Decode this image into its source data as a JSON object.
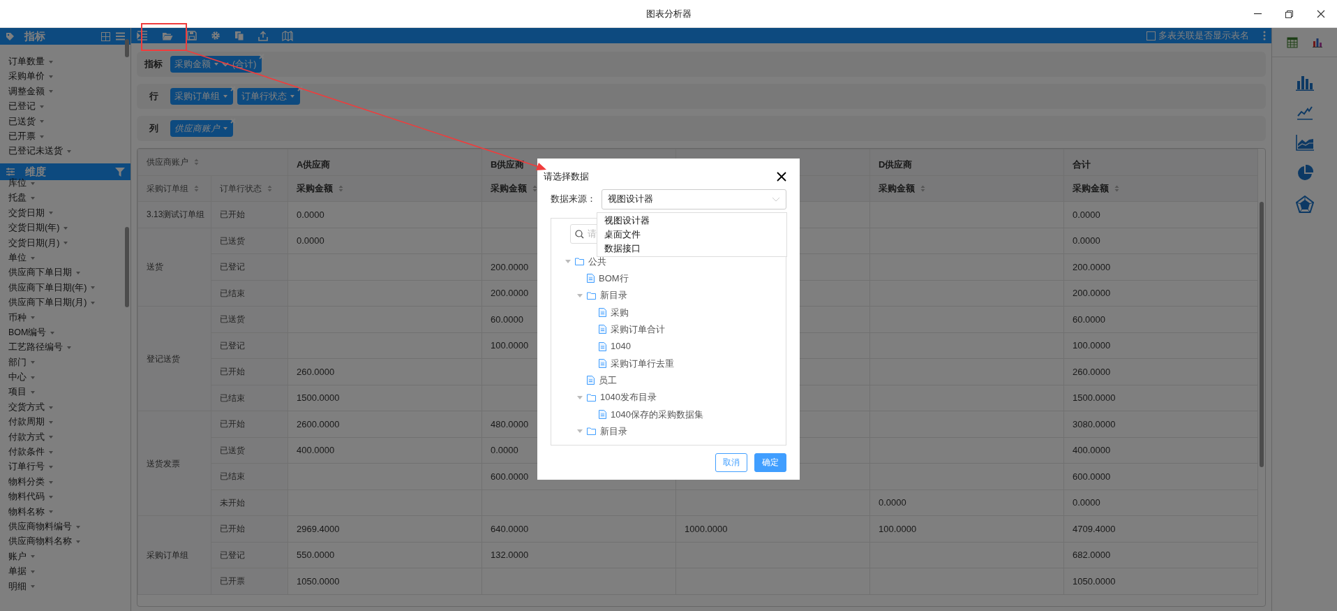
{
  "window": {
    "title": "图表分析器"
  },
  "sidebar": {
    "sections": [
      {
        "title": "指标",
        "kind": "measures",
        "items": [
          "订单数量",
          "采购单价",
          "调整金额",
          "已登记",
          "已送货",
          "已开票",
          "已登记未送货"
        ]
      },
      {
        "title": "维度",
        "kind": "dimensions",
        "items": [
          "库位",
          "托盘",
          "交货日期",
          "交货日期(年)",
          "交货日期(月)",
          "单位",
          "供应商下单日期",
          "供应商下单日期(年)",
          "供应商下单日期(月)",
          "币种",
          "BOM编号",
          "工艺路径编号",
          "部门",
          "中心",
          "项目",
          "交货方式",
          "付款周期",
          "付款方式",
          "付款条件",
          "订单行号",
          "物料分类",
          "物料代码",
          "物料名称",
          "供应商物料编号",
          "供应商物料名称",
          "账户",
          "单据",
          "明细"
        ]
      }
    ]
  },
  "toolbar": {
    "option": {
      "label": "多表关联是否显示表名",
      "checked": false
    }
  },
  "shelves": [
    {
      "label": "指标",
      "chips": [
        {
          "text": "采购金额",
          "suffix": "(合计)",
          "italic": false
        }
      ]
    },
    {
      "label": "行",
      "chips": [
        {
          "text": "采购订单组",
          "italic": false
        },
        {
          "text": "订单行状态",
          "italic": false
        }
      ]
    },
    {
      "label": "列",
      "chips": [
        {
          "text": "供应商账户",
          "italic": true
        }
      ]
    }
  ],
  "pivot": {
    "column_field": "供应商账户",
    "row_headers": [
      "采购订单组",
      "订单行状态"
    ],
    "columns": [
      {
        "kind": "supplier",
        "label": "A供应商",
        "measure": "采购金额"
      },
      {
        "kind": "supplier",
        "label": "B供应商",
        "measure": "采购金额"
      },
      {
        "kind": "covered"
      },
      {
        "kind": "supplier",
        "label": "D供应商",
        "measure": "采购金额"
      },
      {
        "kind": "total",
        "label": "合计",
        "measure": "采购金额"
      }
    ],
    "groups": [
      {
        "label": "3.13测试订单组",
        "rows": [
          {
            "status": "已开始",
            "values": [
              {
                "text": "0.0000"
              },
              {
                "blank": true
              },
              {
                "blank": true
              },
              {
                "blank": true
              },
              {
                "text": "0.0000"
              }
            ]
          }
        ]
      },
      {
        "label": "送货",
        "rows": [
          {
            "status": "已送货",
            "values": [
              {
                "text": "0.0000"
              },
              {
                "blank": true
              },
              {
                "blank": true
              },
              {
                "blank": true
              },
              {
                "text": "0.0000"
              }
            ]
          },
          {
            "status": "已登记",
            "values": [
              {
                "blank": true
              },
              {
                "text": "200.0000"
              },
              {
                "blank": true
              },
              {
                "blank": true
              },
              {
                "text": "200.0000"
              }
            ]
          },
          {
            "status": "已结束",
            "values": [
              {
                "blank": true
              },
              {
                "text": "200.0000"
              },
              {
                "blank": true
              },
              {
                "blank": true
              },
              {
                "text": "200.0000"
              }
            ]
          }
        ]
      },
      {
        "label": "登记送货",
        "rows": [
          {
            "status": "已送货",
            "values": [
              {
                "blank": true
              },
              {
                "text": "60.0000"
              },
              {
                "blank": true
              },
              {
                "blank": true
              },
              {
                "text": "60.0000"
              }
            ]
          },
          {
            "status": "已登记",
            "values": [
              {
                "blank": true
              },
              {
                "text": "100.0000"
              },
              {
                "blank": true
              },
              {
                "blank": true
              },
              {
                "text": "100.0000"
              }
            ]
          },
          {
            "status": "已开始",
            "values": [
              {
                "text": "260.0000"
              },
              {
                "blank": true
              },
              {
                "blank": true
              },
              {
                "blank": true
              },
              {
                "text": "260.0000"
              }
            ]
          },
          {
            "status": "已结束",
            "values": [
              {
                "text": "1500.0000"
              },
              {
                "blank": true
              },
              {
                "blank": true
              },
              {
                "blank": true
              },
              {
                "text": "1500.0000"
              }
            ]
          }
        ]
      },
      {
        "label": "送货发票",
        "rows": [
          {
            "status": "已开始",
            "values": [
              {
                "text": "2600.0000"
              },
              {
                "text": "480.0000"
              },
              {
                "blank": true
              },
              {
                "blank": true
              },
              {
                "text": "3080.0000"
              }
            ]
          },
          {
            "status": "已送货",
            "values": [
              {
                "text": "400.0000"
              },
              {
                "text": "0.0000"
              },
              {
                "blank": true
              },
              {
                "blank": true
              },
              {
                "text": "400.0000"
              }
            ]
          },
          {
            "status": "已结束",
            "values": [
              {
                "blank": true
              },
              {
                "text": "600.0000"
              },
              {
                "blank": true
              },
              {
                "blank": true
              },
              {
                "text": "600.0000"
              }
            ]
          },
          {
            "status": "未开始",
            "values": [
              {
                "blank": true
              },
              {
                "blank": true
              },
              {
                "blank": true
              },
              {
                "text": "0.0000"
              },
              {
                "text": "0.0000"
              }
            ]
          }
        ]
      },
      {
        "label": "采购订单组",
        "rows": [
          {
            "status": "已开始",
            "values": [
              {
                "text": "2969.4000"
              },
              {
                "text": "640.0000"
              },
              {
                "text": "1000.0000"
              },
              {
                "text": "100.0000"
              },
              {
                "text": "4709.4000"
              }
            ]
          },
          {
            "status": "已登记",
            "values": [
              {
                "text": "550.0000"
              },
              {
                "text": "132.0000"
              },
              {
                "blank": true
              },
              {
                "blank": true
              },
              {
                "text": "682.0000"
              }
            ]
          },
          {
            "status": "已开票",
            "values": [
              {
                "text": "1050.0000"
              },
              {
                "blank": true
              },
              {
                "blank": true
              },
              {
                "blank": true
              },
              {
                "text": "1050.0000"
              }
            ]
          }
        ]
      }
    ]
  },
  "dialog": {
    "title": "请选择数据",
    "source_label": "数据来源：",
    "source_value": "视图设计器",
    "options": [
      "视图设计器",
      "桌面文件",
      "数据接口"
    ],
    "search_placeholder": "请",
    "tree": [
      {
        "label": "公共",
        "kind": "folder",
        "expanded": true,
        "children": [
          {
            "label": "BOM行",
            "kind": "file"
          },
          {
            "label": "新目录",
            "kind": "folder",
            "expanded": true,
            "children": [
              {
                "label": "采购",
                "kind": "file"
              },
              {
                "label": "采购订单合计",
                "kind": "file"
              },
              {
                "label": "1040",
                "kind": "file"
              },
              {
                "label": "采购订单行去重",
                "kind": "file"
              }
            ]
          },
          {
            "label": "员工",
            "kind": "file"
          },
          {
            "label": "1040发布目录",
            "kind": "folder",
            "expanded": true,
            "children": [
              {
                "label": "1040保存的采购数据集",
                "kind": "file"
              }
            ]
          },
          {
            "label": "新目录",
            "kind": "folder",
            "expanded": true
          }
        ]
      }
    ],
    "buttons": [
      {
        "label": "取消",
        "kind": "secondary"
      },
      {
        "label": "确定",
        "kind": "primary"
      }
    ]
  }
}
